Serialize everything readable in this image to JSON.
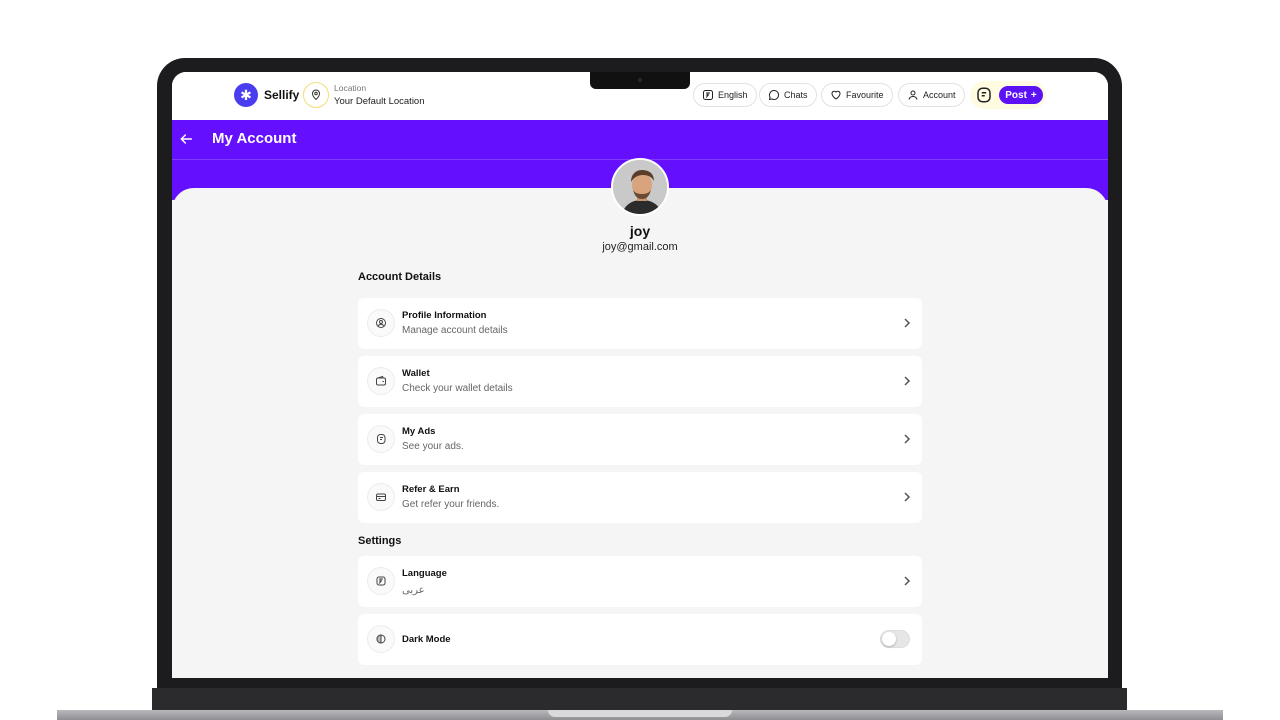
{
  "nav": {
    "brand": "Sellify",
    "location_label": "Location",
    "location_value": "Your Default Location",
    "language": "English",
    "chats": "Chats",
    "favourite": "Favourite",
    "account": "Account",
    "post": "Post",
    "post_plus": "+"
  },
  "header": {
    "title": "My Account",
    "back_arrow": "←"
  },
  "profile": {
    "name": "joy",
    "email": "joy@gmail.com"
  },
  "account_details": {
    "title": "Account Details",
    "items": [
      {
        "title": "Profile Information",
        "subtitle": "Manage account details",
        "icon": "user-circle-icon"
      },
      {
        "title": "Wallet",
        "subtitle": "Check your wallet details",
        "icon": "wallet-icon"
      },
      {
        "title": "My Ads",
        "subtitle": "See your ads.",
        "icon": "ads-icon"
      },
      {
        "title": "Refer & Earn",
        "subtitle": "Get refer your friends.",
        "icon": "card-icon"
      }
    ]
  },
  "settings": {
    "title": "Settings",
    "language": {
      "title": "Language",
      "subtitle": "عربى",
      "icon": "translate-icon"
    },
    "dark_mode": {
      "title": "Dark Mode",
      "enabled": false,
      "icon": "theme-icon"
    }
  },
  "colors": {
    "accent": "#6410ff",
    "post_button": "#5b12f5",
    "logo": "#4a3df0",
    "pin_ring": "#f3dd74"
  }
}
